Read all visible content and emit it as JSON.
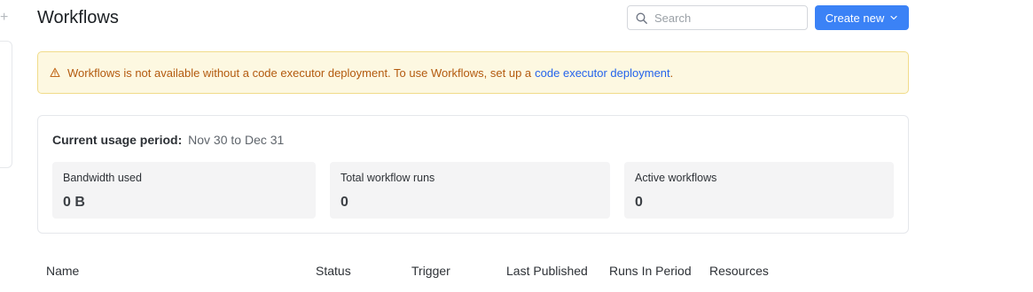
{
  "page": {
    "title": "Workflows"
  },
  "left_rail": {
    "plus_glyph": "+"
  },
  "search": {
    "placeholder": "Search",
    "value": ""
  },
  "create_button": {
    "label": "Create new",
    "color": "#3b82f6"
  },
  "alert": {
    "message": "Workflows is not available without a code executor deployment. To use Workflows, set up a",
    "link_text": "code executor deployment",
    "suffix": ".",
    "text_color": "#b35a0e",
    "background": "#fdf8e1",
    "link_color": "#2563eb",
    "icon": "warning-triangle-icon"
  },
  "usage": {
    "period_label": "Current usage period:",
    "period_value": "Nov 30 to Dec 31",
    "stats": [
      {
        "label": "Bandwidth used",
        "value": "0 B"
      },
      {
        "label": "Total workflow runs",
        "value": "0"
      },
      {
        "label": "Active workflows",
        "value": "0"
      }
    ]
  },
  "table": {
    "columns": [
      "Name",
      "Status",
      "Trigger",
      "Last Published",
      "Runs In Period",
      "Resources"
    ]
  }
}
